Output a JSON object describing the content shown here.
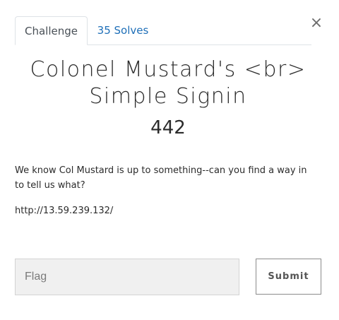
{
  "tabs": [
    {
      "label": "Challenge",
      "active": true
    },
    {
      "label": "35 Solves",
      "active": false
    }
  ],
  "close_label": "×",
  "challenge": {
    "title_line1": "Colonel Mustard's <br>",
    "title_line2": "Simple Signin",
    "points": "442",
    "description": "We know Col Mustard is up to something--can you find a way in to tell us what?",
    "url": "http://13.59.239.132/"
  },
  "form": {
    "flag_placeholder": "Flag",
    "flag_value": "",
    "submit_label": "Submit"
  },
  "colors": {
    "link": "#1e6fb8",
    "input_bg": "#f0f0f0",
    "button_border": "#8c8c8c"
  }
}
